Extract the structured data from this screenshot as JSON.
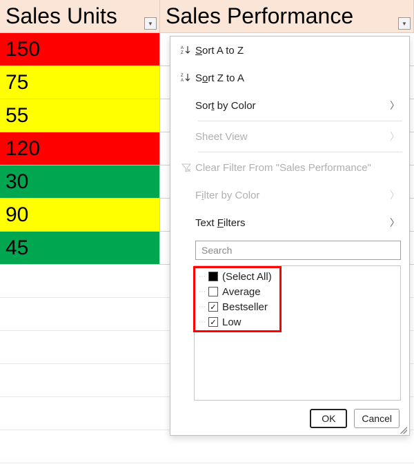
{
  "columns": {
    "a": {
      "header": "Sales Units"
    },
    "b": {
      "header": "Sales Performance"
    }
  },
  "rows": [
    {
      "value": "150",
      "color": "red"
    },
    {
      "value": "75",
      "color": "yellow"
    },
    {
      "value": "55",
      "color": "yellow"
    },
    {
      "value": "120",
      "color": "red"
    },
    {
      "value": "30",
      "color": "green"
    },
    {
      "value": "90",
      "color": "yellow"
    },
    {
      "value": "45",
      "color": "green"
    }
  ],
  "dropdown": {
    "sort_az": "Sort A to Z",
    "sort_za": "Sort Z to A",
    "sort_color": "Sort by Color",
    "sheet_view": "Sheet View",
    "clear_filter": "Clear Filter From \"Sales Performance\"",
    "filter_color": "Filter by Color",
    "text_filters": "Text Filters",
    "search_placeholder": "Search",
    "options": {
      "select_all": "(Select All)",
      "average": "Average",
      "bestseller": "Bestseller",
      "low": "Low"
    },
    "ok": "OK",
    "cancel": "Cancel"
  }
}
